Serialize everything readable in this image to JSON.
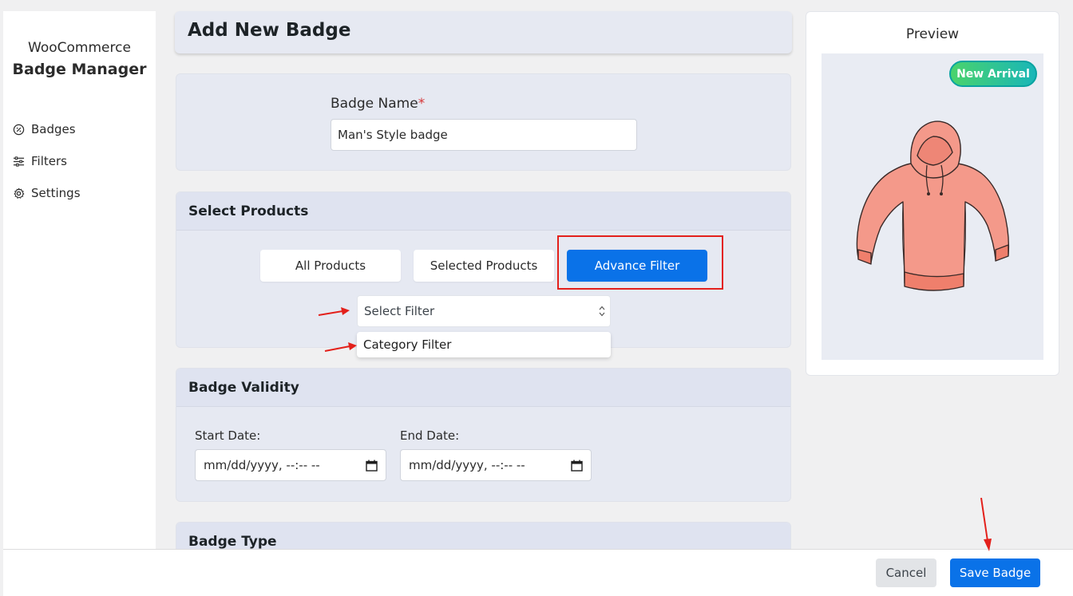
{
  "sidebar": {
    "brand_top": "WooCommerce",
    "brand_main": "Badge Manager",
    "items": [
      {
        "label": "Badges",
        "icon": "badge-icon"
      },
      {
        "label": "Filters",
        "icon": "sliders-icon"
      },
      {
        "label": "Settings",
        "icon": "gear-icon"
      }
    ]
  },
  "header": {
    "title": "Add New Badge"
  },
  "badge_name": {
    "label": "Badge Name",
    "required_mark": "*",
    "value": "Man's Style badge"
  },
  "select_products": {
    "heading": "Select Products",
    "options": [
      "All Products",
      "Selected Products",
      "Advance Filter"
    ],
    "active": "Advance Filter",
    "filter_select": {
      "value": "Select Filter"
    },
    "dropdown_options": [
      "Category Filter"
    ]
  },
  "validity": {
    "heading": "Badge Validity",
    "start_label": "Start Date:",
    "start_value": "mm/dd/yyyy, --:-- --",
    "end_label": "End Date:",
    "end_value": "mm/dd/yyyy, --:-- --"
  },
  "badge_type": {
    "heading": "Badge Type"
  },
  "preview": {
    "title": "Preview",
    "badge_text": "New Arrival"
  },
  "footer": {
    "cancel_label": "Cancel",
    "save_label": "Save Badge"
  },
  "colors": {
    "accent": "#0a72e8",
    "annotation": "#e3201b",
    "card_bg": "#e6e9f2",
    "badge_gradient_start": "#4ad36c",
    "badge_gradient_end": "#19b6b8"
  }
}
